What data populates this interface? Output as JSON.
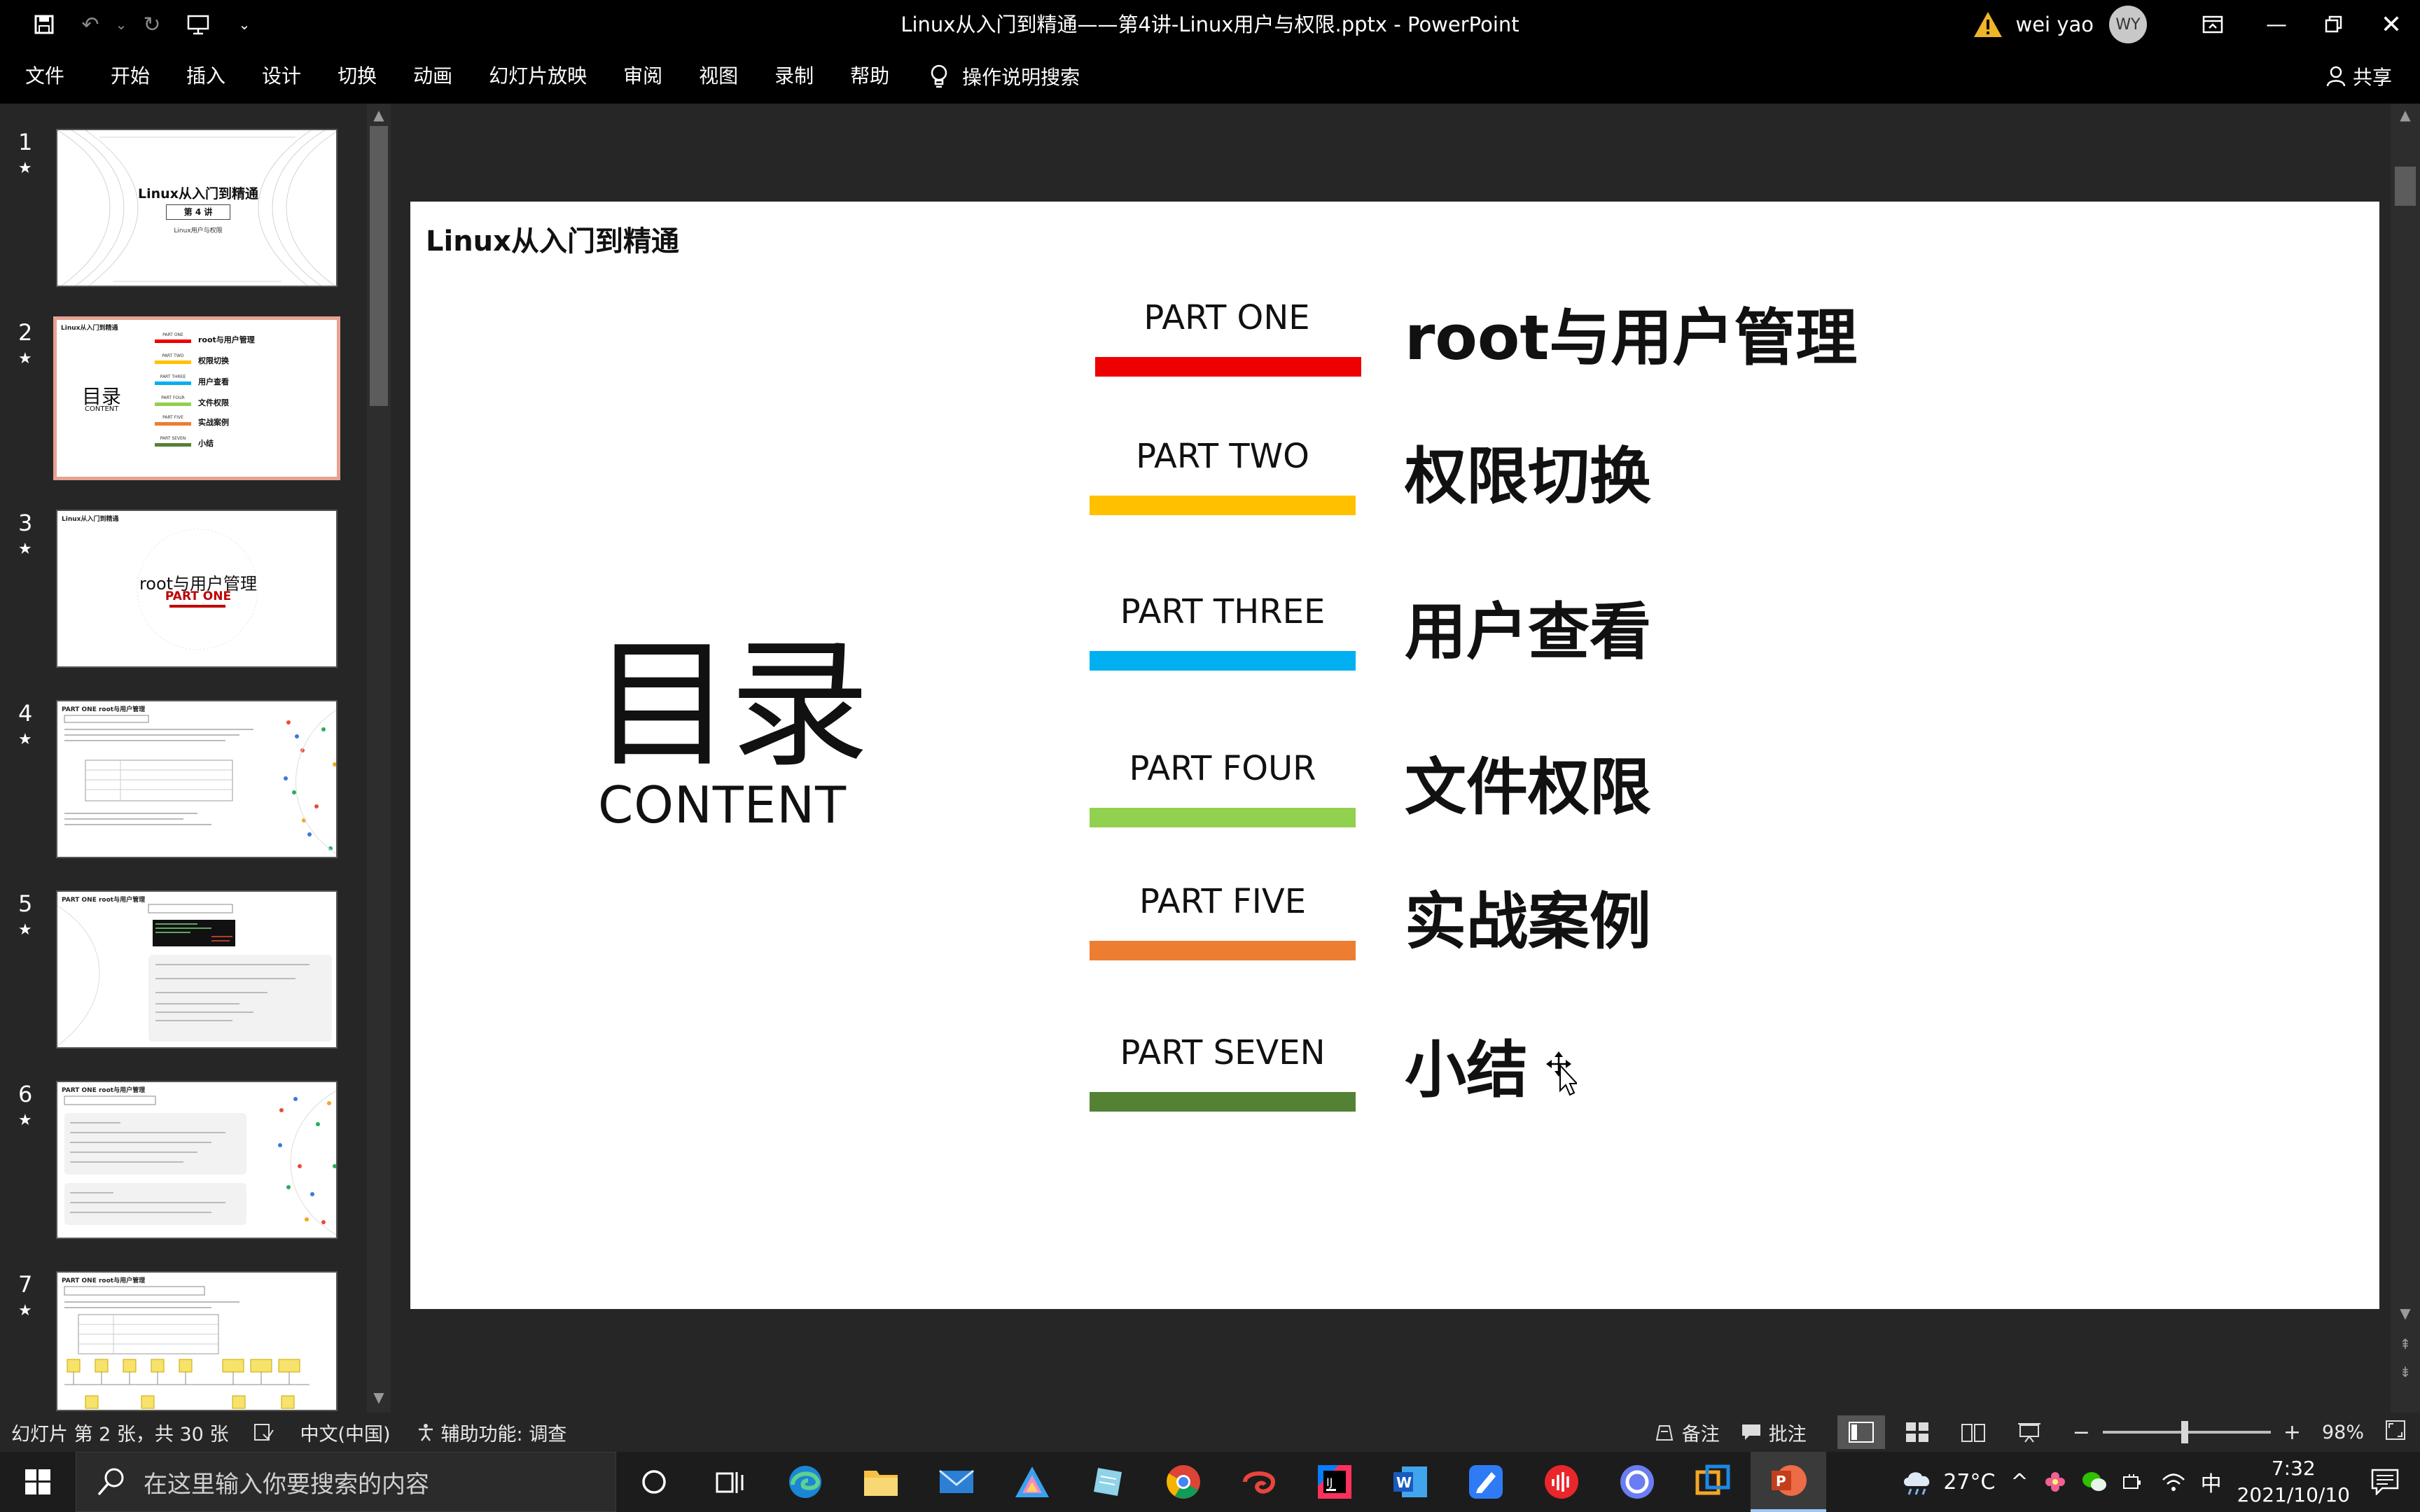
{
  "titlebar": {
    "title": "Linux从入门到精通——第4讲-Linux用户与权限.pptx  -  PowerPoint",
    "user_name": "wei yao",
    "avatar_initials": "WY"
  },
  "ribbon": {
    "tabs": [
      "文件",
      "开始",
      "插入",
      "设计",
      "切换",
      "动画",
      "幻灯片放映",
      "审阅",
      "视图",
      "录制",
      "帮助"
    ],
    "tell_me": "操作说明搜索",
    "share": "共享"
  },
  "thumbnails": [
    {
      "num": "1",
      "star": "★",
      "title": "Linux从入门到精通",
      "badge": "第 4 讲",
      "sub": "Linux用户与权限"
    },
    {
      "num": "2",
      "star": "★",
      "title": "Linux从入门到精通",
      "toc": "目录",
      "toc_sub": "CONTENT",
      "items": [
        "root与用户管理",
        "权限切换",
        "用户查看",
        "文件权限",
        "实战案例",
        "小结"
      ],
      "parts": [
        "PART ONE",
        "PART TWO",
        "PART THREE",
        "PART FOUR",
        "PART FIVE",
        "PART SEVEN"
      ]
    },
    {
      "num": "3",
      "star": "★",
      "title": "Linux从入门到精通",
      "heading": "root与用户管理",
      "part": "PART ONE"
    },
    {
      "num": "4",
      "star": "★",
      "title": "PART ONE root与用户管理"
    },
    {
      "num": "5",
      "star": "★",
      "title": "PART ONE root与用户管理"
    },
    {
      "num": "6",
      "star": "★",
      "title": "PART ONE root与用户管理"
    },
    {
      "num": "7",
      "star": "★",
      "title": "PART ONE root与用户管理"
    }
  ],
  "slide": {
    "title": "Linux从入门到精通",
    "toc": "目录",
    "toc_sub": "CONTENT",
    "parts": [
      {
        "label": "PART ONE",
        "text": "root与用户管理",
        "color": "#ee0000"
      },
      {
        "label": "PART TWO",
        "text": "权限切换",
        "color": "#ffc000"
      },
      {
        "label": "PART THREE",
        "text": "用户查看",
        "color": "#00b0f0"
      },
      {
        "label": "PART FOUR",
        "text": "文件权限",
        "color": "#92d050"
      },
      {
        "label": "PART FIVE",
        "text": "实战案例",
        "color": "#ed7d31"
      },
      {
        "label": "PART SEVEN",
        "text": "小结",
        "color": "#548235"
      }
    ]
  },
  "statusbar": {
    "slide_info": "幻灯片 第 2 张，共 30 张",
    "language": "中文(中国)",
    "accessibility": "辅助功能: 调查",
    "notes": "备注",
    "comments": "批注",
    "zoom": "98%"
  },
  "taskbar": {
    "search_placeholder": "在这里输入你要搜索的内容",
    "weather": "27°C",
    "ime": "中",
    "time": "7:32",
    "date": "2021/10/10"
  }
}
